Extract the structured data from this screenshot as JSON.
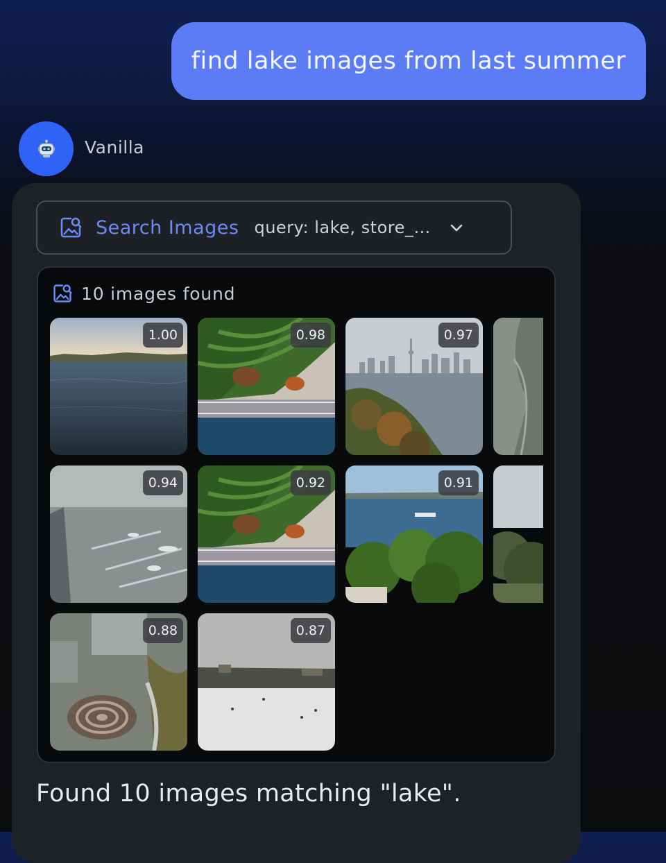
{
  "user_message": "find lake images from last summer",
  "assistant": {
    "avatar_icon": "robot-icon",
    "name": "Vanilla"
  },
  "tool_call": {
    "icon": "image-search-icon",
    "name": "Search Images",
    "args": "query: lake, store_…",
    "expand_icon": "chevron-down-icon"
  },
  "results": {
    "icon": "image-search-icon",
    "count_label": "10 images found",
    "images": [
      {
        "score": "1.00"
      },
      {
        "score": "0.98"
      },
      {
        "score": "0.97"
      },
      {
        "score": ""
      },
      {
        "score": "0.94"
      },
      {
        "score": "0.92"
      },
      {
        "score": "0.91"
      },
      {
        "score": ""
      },
      {
        "score": "0.88"
      },
      {
        "score": "0.87"
      }
    ]
  },
  "summary": "Found 10 images matching \"lake\".",
  "colors": {
    "user_bubble": "#5b7cf4",
    "avatar": "#2f63f6",
    "accent_text": "#6a8bf5",
    "card": "#1e2227",
    "results_bg": "#080a0c"
  }
}
